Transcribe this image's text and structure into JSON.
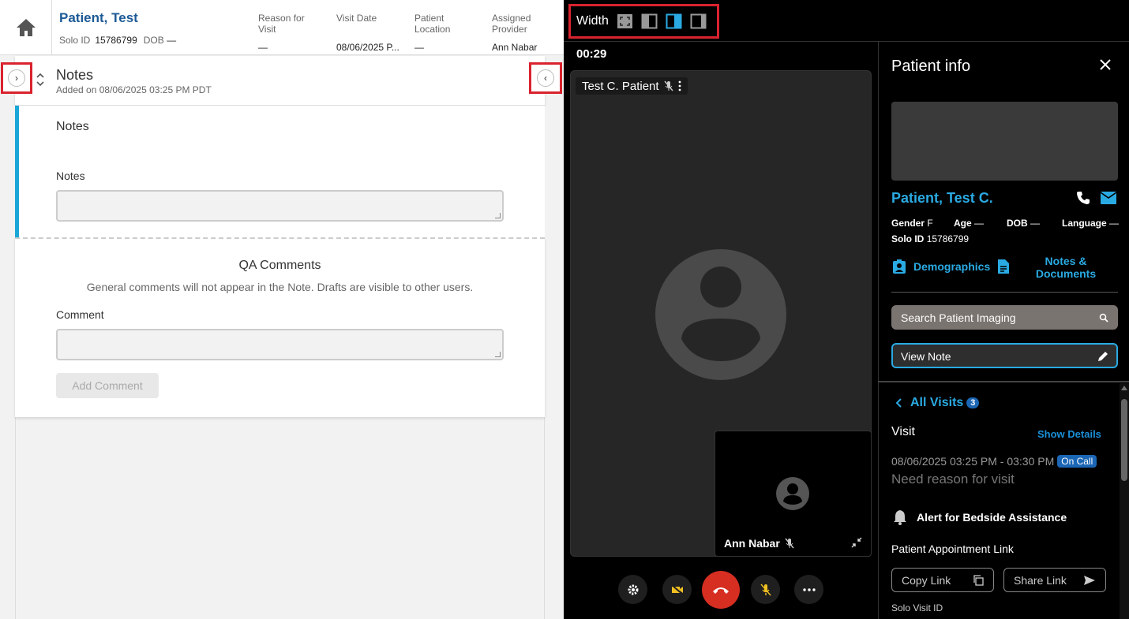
{
  "header": {
    "patient_name": "Patient, Test",
    "solo_id_label": "Solo ID",
    "solo_id_value": "15786799",
    "dob_label": "DOB",
    "dob_value": "—",
    "columns": [
      {
        "label": "Reason for Visit",
        "value": "—"
      },
      {
        "label": "Visit Date",
        "value": "08/06/2025 P..."
      },
      {
        "label": "Patient Location",
        "value": "—"
      },
      {
        "label": "Assigned Provider",
        "value": "Ann Nabar"
      }
    ]
  },
  "notes_card": {
    "title": "Notes",
    "added_on": "Added on 08/06/2025 03:25 PM PDT",
    "section_title": "Notes",
    "field_label": "Notes",
    "qa_title": "QA Comments",
    "qa_subtitle": "General comments will not appear in the Note. Drafts are visible to other users.",
    "comment_label": "Comment",
    "add_comment": "Add Comment"
  },
  "video": {
    "width_label": "Width",
    "timer": "00:29",
    "remote_name": "Test C. Patient",
    "local_name": "Ann Nabar"
  },
  "patient_info": {
    "title": "Patient info",
    "name": "Patient, Test C.",
    "gender_label": "Gender",
    "gender_value": "F",
    "age_label": "Age",
    "age_value": "—",
    "dob_label": "DOB",
    "dob_value": "—",
    "language_label": "Language",
    "language_value": "—",
    "solo_id_label": "Solo ID",
    "solo_id_value": "15786799",
    "demographics": "Demographics",
    "notes_docs": "Notes & Documents",
    "search_imaging": "Search Patient Imaging",
    "view_note": "View Note",
    "all_visits": "All Visits",
    "visit_count": "3",
    "visit_label": "Visit",
    "show_details": "Show Details",
    "visit_time": "08/06/2025 03:25 PM - 03:30 PM",
    "on_call": "On Call",
    "reason": "Need reason for visit",
    "alert": "Alert for Bedside Assistance",
    "appt_link": "Patient Appointment Link",
    "copy_link": "Copy Link",
    "share_link": "Share Link",
    "solo_visit_id": "Solo Visit ID"
  },
  "colors": {
    "accent_blue": "#2aaae2",
    "brand_blue": "#1d5a96",
    "end_call_red": "#d62e21",
    "highlight_red": "#d9232e",
    "notes_bar": "#1aa7d8"
  }
}
